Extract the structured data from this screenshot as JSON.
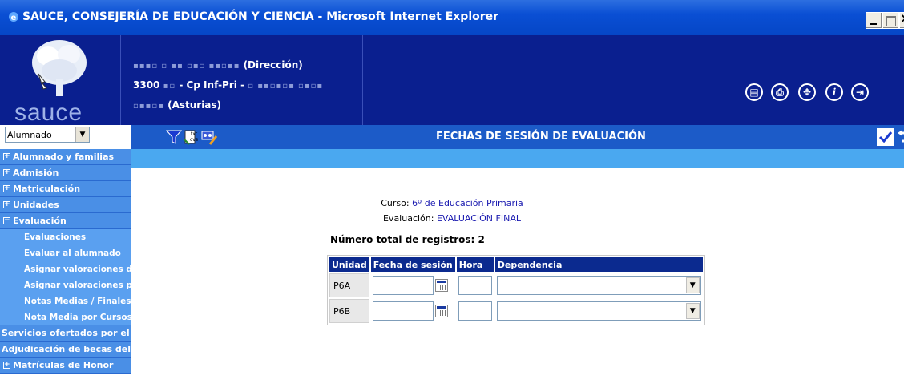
{
  "window": {
    "title": "SAUCE, CONSEJERÍA DE EDUCACIÓN Y CIENCIA - Microsoft Internet Explorer"
  },
  "header": {
    "logo_text": "sauce",
    "school_line1_suffix": "(Dirección)",
    "school_line2_code": "3300",
    "school_line2_type": "- Cp Inf-Pri -",
    "school_line3_suffix": "(Asturias)"
  },
  "sidebar": {
    "selector_value": "Alumnado",
    "items": [
      {
        "label": "Alumnado y familias",
        "expander": "+"
      },
      {
        "label": "Admisión",
        "expander": "+"
      },
      {
        "label": "Matriculación",
        "expander": "+"
      },
      {
        "label": "Unidades",
        "expander": "+"
      },
      {
        "label": "Evaluación",
        "expander": "−"
      },
      {
        "label": "Evaluaciones"
      },
      {
        "label": "Evaluar al alumnado"
      },
      {
        "label": "Asignar valoraciones de"
      },
      {
        "label": "Asignar valoraciones por"
      },
      {
        "label": "Notas Medias / Finales"
      },
      {
        "label": "Nota Media por Cursos"
      },
      {
        "label": "Servicios ofertados por el ce"
      },
      {
        "label": "Adjudicación de becas del alu"
      },
      {
        "label": "Matrículas de Honor",
        "expander": "+"
      }
    ]
  },
  "page": {
    "title": "FECHAS DE SESIÓN DE EVALUACIÓN",
    "curso_label": "Curso:",
    "curso_value": "6º de Educación Primaria",
    "evaluacion_label": "Evaluación:",
    "evaluacion_value": "EVALUACIÓN FINAL",
    "total_records": "Número total de registros: 2"
  },
  "table": {
    "headers": [
      "Unidad",
      "Fecha de sesión",
      "Hora",
      "Dependencia"
    ],
    "rows": [
      {
        "unidad": "P6A",
        "fecha": "",
        "hora": "",
        "dependencia": ""
      },
      {
        "unidad": "P6B",
        "fecha": "",
        "hora": "",
        "dependencia": ""
      }
    ]
  },
  "icons": {
    "toolbar_left": [
      "filter-icon",
      "export-txt-csv-icon",
      "edit-icon"
    ],
    "toolbar_right": [
      "accept-check-icon",
      "undo-icon"
    ],
    "header_right": [
      "notes-icon",
      "print-icon",
      "navigate-icon",
      "info-icon",
      "exit-icon"
    ]
  },
  "colors": {
    "header_bg": "#0a1f8f",
    "toolbar_bg": "#1c5bc8",
    "menu_bg": "#4a8fe6",
    "table_header_bg": "#0b2a8f"
  }
}
